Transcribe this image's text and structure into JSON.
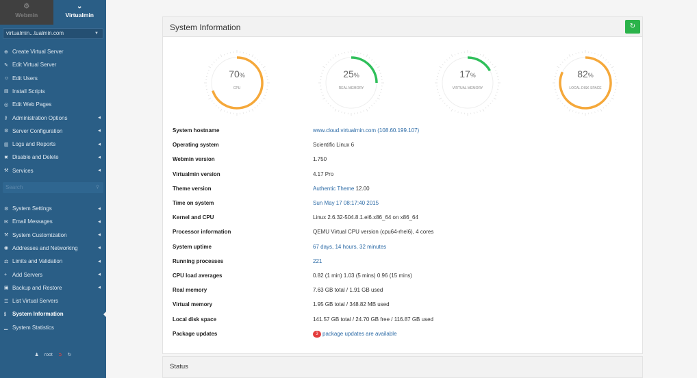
{
  "top_tabs": [
    {
      "label": "Webmin",
      "icon": "gear-icon",
      "active": false
    },
    {
      "label": "Virtualmin",
      "icon": "chevron-down-icon",
      "active": true
    }
  ],
  "domain_select": {
    "value": "virtualmin...tualmin.com"
  },
  "menu_group_1": [
    {
      "label": "Create Virtual Server",
      "icon": "plus-circle-icon",
      "submenu": false
    },
    {
      "label": "Edit Virtual Server",
      "icon": "edit-icon",
      "submenu": false
    },
    {
      "label": "Edit Users",
      "icon": "users-icon",
      "submenu": false
    },
    {
      "label": "Install Scripts",
      "icon": "file-icon",
      "submenu": false
    },
    {
      "label": "Edit Web Pages",
      "icon": "globe-icon",
      "submenu": false
    },
    {
      "label": "Administration Options",
      "icon": "key-icon",
      "submenu": true
    },
    {
      "label": "Server Configuration",
      "icon": "cogs-icon",
      "submenu": true
    },
    {
      "label": "Logs and Reports",
      "icon": "report-icon",
      "submenu": true
    },
    {
      "label": "Disable and Delete",
      "icon": "delete-icon",
      "submenu": true
    },
    {
      "label": "Services",
      "icon": "services-icon",
      "submenu": true
    }
  ],
  "search": {
    "placeholder": "Search"
  },
  "menu_group_2": [
    {
      "label": "System Settings",
      "icon": "settings-icon",
      "submenu": true
    },
    {
      "label": "Email Messages",
      "icon": "envelope-icon",
      "submenu": true
    },
    {
      "label": "System Customization",
      "icon": "wrench-icon",
      "submenu": true
    },
    {
      "label": "Addresses and Networking",
      "icon": "network-icon",
      "submenu": true
    },
    {
      "label": "Limits and Validation",
      "icon": "limits-icon",
      "submenu": true
    },
    {
      "label": "Add Servers",
      "icon": "plus-icon",
      "submenu": true
    },
    {
      "label": "Backup and Restore",
      "icon": "backup-icon",
      "submenu": true
    },
    {
      "label": "List Virtual Servers",
      "icon": "list-icon",
      "submenu": false
    },
    {
      "label": "System Information",
      "icon": "info-icon",
      "submenu": false,
      "active": true
    },
    {
      "label": "System Statistics",
      "icon": "chart-icon",
      "submenu": false
    }
  ],
  "user_bar": {
    "username": "root"
  },
  "panel": {
    "title": "System Information"
  },
  "gauges": [
    {
      "value": 70,
      "label": "CPU",
      "color": "#f5a83a"
    },
    {
      "value": 25,
      "label": "REAL MEMORY",
      "color": "#2fbf5a"
    },
    {
      "value": 17,
      "label": "VIRTUAL MEMORY",
      "color": "#2fbf5a"
    },
    {
      "value": 82,
      "label": "LOCAL DISK SPACE",
      "color": "#f5a83a"
    }
  ],
  "info_rows": [
    {
      "label": "System hostname",
      "value": "www.cloud.virtualmin.com (108.60.199.107)",
      "link": true
    },
    {
      "label": "Operating system",
      "value": "Scientific Linux 6",
      "link": false
    },
    {
      "label": "Webmin version",
      "value": "1.750",
      "link": false
    },
    {
      "label": "Virtualmin version",
      "value": "4.17 Pro",
      "link": false
    },
    {
      "label": "Theme version",
      "value": "Authentic Theme 12.00",
      "link": true,
      "link_part": "Authentic Theme"
    },
    {
      "label": "Time on system",
      "value": "Sun May 17 08:17:40 2015",
      "link": true
    },
    {
      "label": "Kernel and CPU",
      "value": "Linux 2.6.32-504.8.1.el6.x86_64 on x86_64",
      "link": false
    },
    {
      "label": "Processor information",
      "value": "QEMU Virtual CPU version (cpu64-rhel6), 4 cores",
      "link": false
    },
    {
      "label": "System uptime",
      "value": "67 days, 14 hours, 32 minutes",
      "link": true
    },
    {
      "label": "Running processes",
      "value": "221",
      "link": true
    },
    {
      "label": "CPU load averages",
      "value": "0.82 (1 min) 1.03 (5 mins) 0.96 (15 mins)",
      "link": false
    },
    {
      "label": "Real memory",
      "value": "7.63 GB total / 1.91 GB used",
      "link": false
    },
    {
      "label": "Virtual memory",
      "value": "1.95 GB total / 348.82 MB used",
      "link": false
    },
    {
      "label": "Local disk space",
      "value": "141.57 GB total / 24.70 GB free / 116.87 GB used",
      "link": false
    },
    {
      "label": "Package updates",
      "value": "package updates are available",
      "link": true,
      "badge": "3"
    }
  ],
  "status_panel": {
    "title": "Status"
  }
}
